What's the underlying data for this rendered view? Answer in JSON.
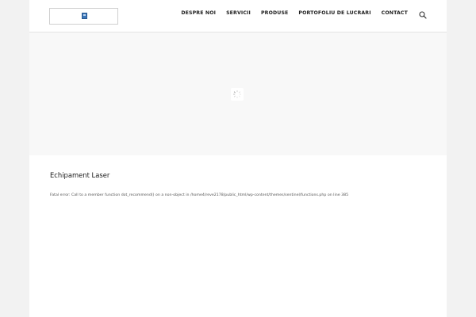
{
  "header": {
    "nav": [
      "DESPRE NOI",
      "SERVICII",
      "PRODUSE",
      "PORTOFOLIU DE LUCRARI",
      "CONTACT"
    ],
    "search_icon": "search-icon"
  },
  "hero": {
    "loader_icon": "loading-spinner-icon"
  },
  "content": {
    "title": "Echipament Laser",
    "error": "Fatal error: Call to a member function dot_recommend() on a non-object in /home4/reve2178/public_html/wp-content/themes/sentinel/functions.php on line 385"
  },
  "colors": {
    "outer_background": "#f2f2f2",
    "page_background": "#ffffff",
    "hero_background": "#f8f8f8",
    "logo_accent": "#3b76b8",
    "nav_text": "#222222",
    "body_text": "#555555"
  }
}
